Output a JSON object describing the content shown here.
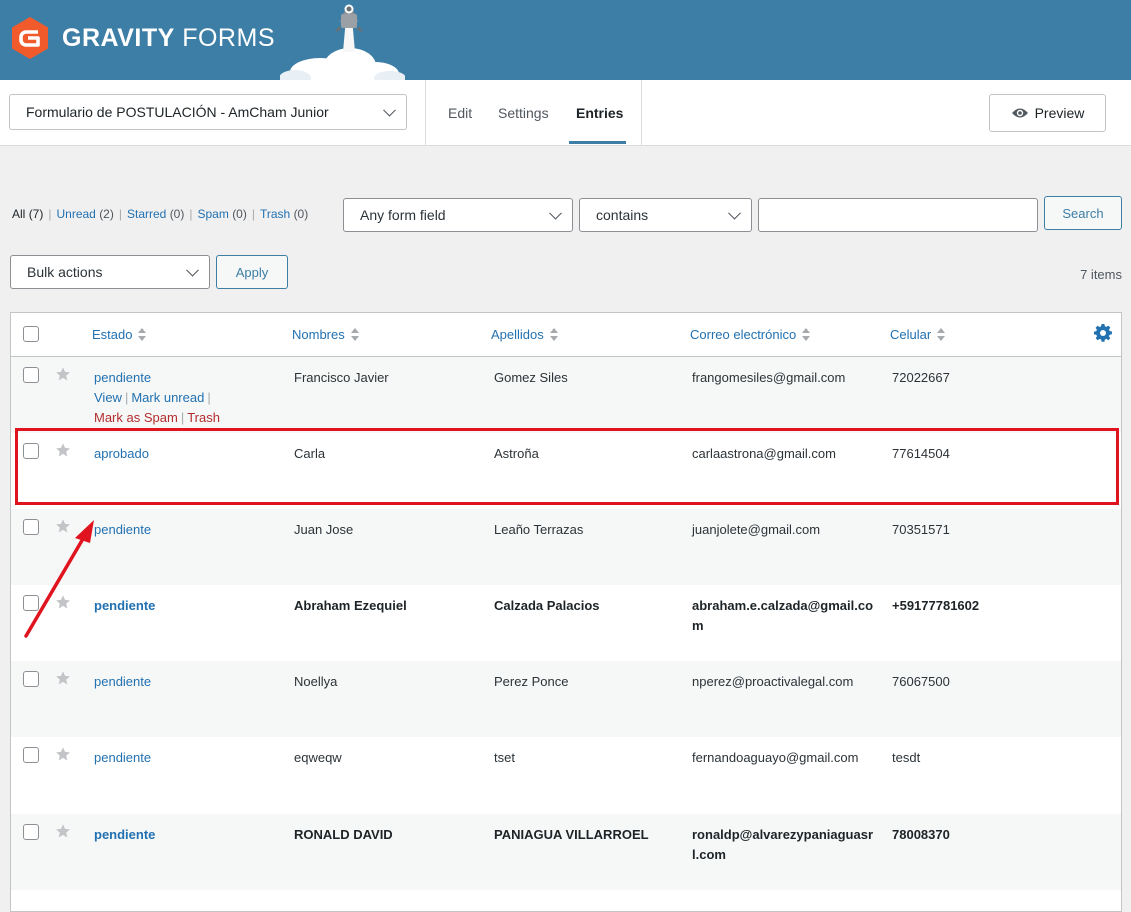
{
  "brand": {
    "name_bold": "GRAVITY",
    "name_light": "FORMS"
  },
  "header": {
    "form_title": "Formulario de POSTULACIÓN - AmCham Junior",
    "tabs": [
      {
        "label": "Edit"
      },
      {
        "label": "Settings"
      },
      {
        "label": "Entries"
      }
    ],
    "active_tab": "Entries",
    "preview_label": "Preview"
  },
  "filters": {
    "all": {
      "label": "All",
      "count": "(7)"
    },
    "unread": {
      "label": "Unread",
      "count": "(2)"
    },
    "starred": {
      "label": "Starred",
      "count": "(0)"
    },
    "spam": {
      "label": "Spam",
      "count": "(0)"
    },
    "trash": {
      "label": "Trash",
      "count": "(0)"
    }
  },
  "search": {
    "field": "Any form field",
    "operator": "contains",
    "value": "",
    "button": "Search"
  },
  "bulk": {
    "label": "Bulk actions",
    "apply": "Apply"
  },
  "items_count": "7 items",
  "table": {
    "columns": [
      "Estado",
      "Nombres",
      "Apellidos",
      "Correo electrónico",
      "Celular"
    ],
    "rows": [
      {
        "estado": "pendiente",
        "nombres": "Francisco Javier",
        "apellidos": "Gomez Siles",
        "correo": "frangomesiles@gmail.com",
        "celular": "72022667"
      },
      {
        "estado": "aprobado",
        "nombres": "Carla",
        "apellidos": "Astroña",
        "correo": "carlaastrona@gmail.com",
        "celular": "77614504"
      },
      {
        "estado": "pendiente",
        "nombres": "Juan Jose",
        "apellidos": "Leaño Terrazas",
        "correo": "juanjolete@gmail.com",
        "celular": "70351571"
      },
      {
        "estado": "pendiente",
        "nombres": "Abraham Ezequiel",
        "apellidos": "Calzada Palacios",
        "correo_l1": "abraham.e.calzada@gmail.co",
        "correo_l2": "m",
        "celular": "+59177781602"
      },
      {
        "estado": "pendiente",
        "nombres": "Noellya",
        "apellidos": "Perez Ponce",
        "correo": "nperez@proactivalegal.com",
        "celular": "76067500"
      },
      {
        "estado": "pendiente",
        "nombres": "eqweqw",
        "apellidos": "tset",
        "correo": "fernandoaguayo@gmail.com",
        "celular": "tesdt"
      },
      {
        "estado": "pendiente",
        "nombres": "RONALD DAVID",
        "apellidos": "PANIAGUA VILLARROEL",
        "correo_l1": "ronaldp@alvarezypaniaguasr",
        "correo_l2": "l.com",
        "celular": "78008370"
      }
    ],
    "row_actions": {
      "view": "View",
      "mark_unread": "Mark unread",
      "mark_spam": "Mark as Spam",
      "trash": "Trash"
    }
  },
  "colors": {
    "brand_bar": "#3d7ea6",
    "link": "#2271b1",
    "danger": "#b32d2e",
    "highlight": "#e0141e"
  }
}
